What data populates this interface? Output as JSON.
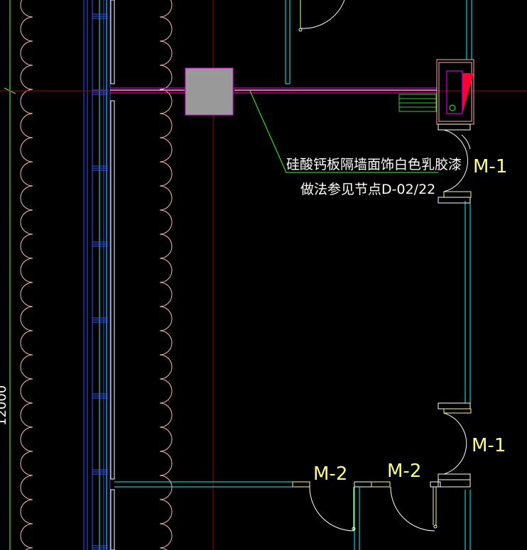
{
  "drawing": {
    "background": "#000000",
    "colors": {
      "wall": "#ffffff",
      "glazing": "#33ccff",
      "cyan": "#00ffff",
      "blue": "#3355ff",
      "magenta": "#ff00ff",
      "crosshair": "#aa0000",
      "leader": "#33ff33",
      "dimension": "#66ff66",
      "yellow": "#ffff66",
      "gray_fill": "#999999",
      "red_fill": "#ff0033",
      "hatch": "#33cc33",
      "pink_outline": "#ffaaaa",
      "scallop": "#ffbbbb"
    }
  },
  "annotation": {
    "line1": "硅酸钙板隔墙面饰白色乳胶漆",
    "line2": "做法参见节点D-02/22"
  },
  "doors": [
    {
      "tag": "M-1"
    },
    {
      "tag": "M-1"
    },
    {
      "tag": "M-2"
    },
    {
      "tag": "M-2"
    }
  ],
  "dimension": {
    "text": "12000"
  }
}
